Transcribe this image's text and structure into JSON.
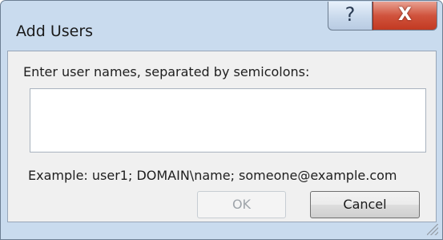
{
  "window": {
    "title": "Add Users",
    "help_glyph": "?",
    "close_glyph": "X"
  },
  "form": {
    "prompt": "Enter user names, separated by semicolons:",
    "names_value": "",
    "names_placeholder": "",
    "example": "Example: user1; DOMAIN\\name; someone@example.com"
  },
  "buttons": {
    "ok_label": "OK",
    "ok_enabled": false,
    "cancel_label": "Cancel"
  },
  "colors": {
    "frame": "#c9dbee",
    "client": "#f0f0f0",
    "close_button": "#c94a33"
  }
}
